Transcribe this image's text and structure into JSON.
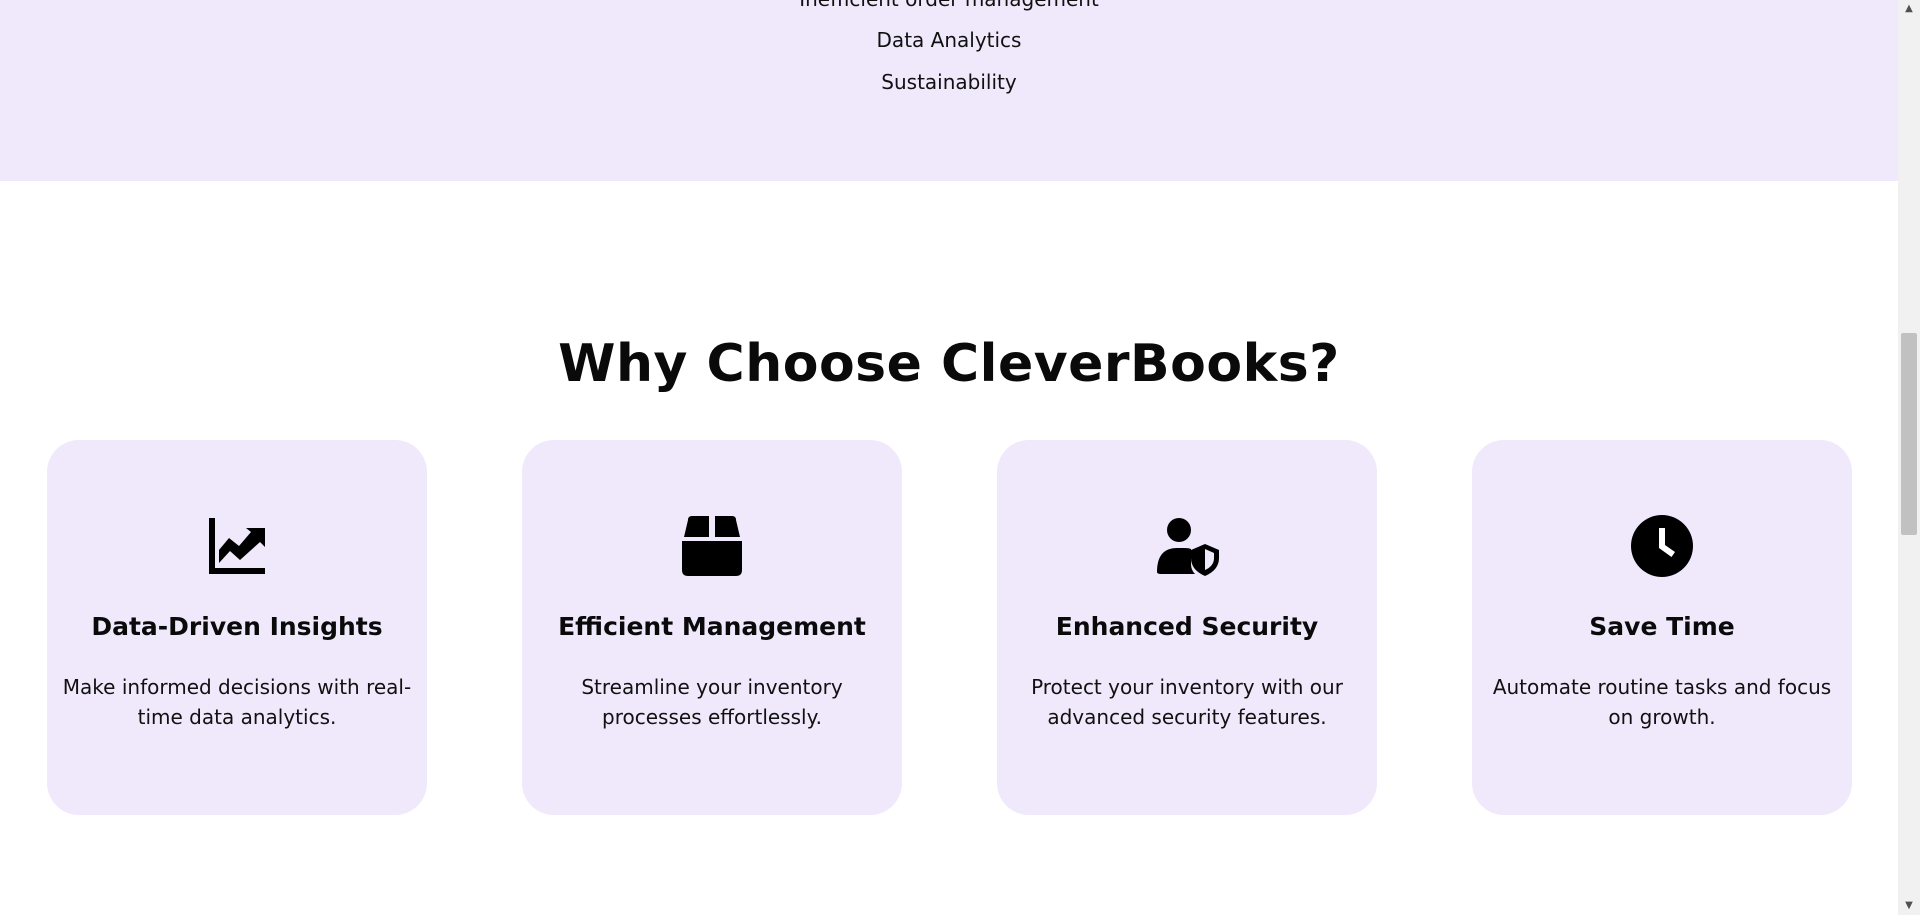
{
  "problems": {
    "items": [
      "Inefficient order management",
      "Data Analytics",
      "Sustainability"
    ]
  },
  "why": {
    "title": "Why Choose CleverBooks?",
    "cards": [
      {
        "icon": "chart-line-icon",
        "title": "Data-Driven Insights",
        "description": "Make informed decisions with real-time data analytics."
      },
      {
        "icon": "box-icon",
        "title": "Efficient Management",
        "description": "Streamline your inventory processes effortlessly."
      },
      {
        "icon": "user-shield-icon",
        "title": "Enhanced Security",
        "description": "Protect your inventory with our advanced security features."
      },
      {
        "icon": "clock-icon",
        "title": "Save Time",
        "description": "Automate routine tasks and focus on growth."
      }
    ]
  },
  "colors": {
    "lavender": "#f0e8fb",
    "text": "#0a0a0a",
    "background": "#ffffff"
  }
}
